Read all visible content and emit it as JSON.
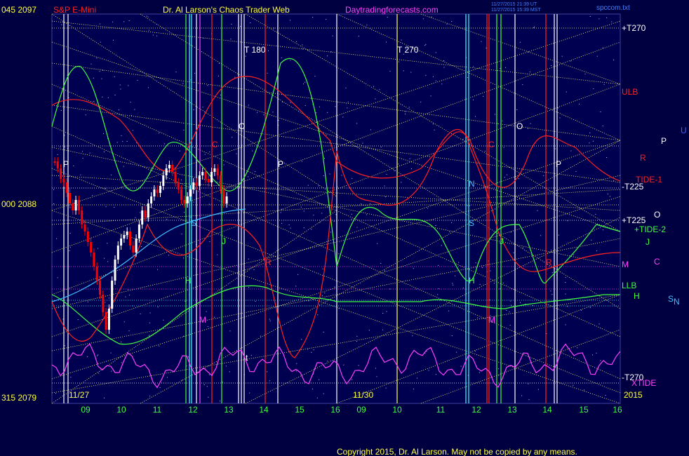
{
  "header": {
    "left_price": "045  2097",
    "instrument": "S&P E-Mini",
    "title": "Dr. Al Larson's Chaos Trader Web",
    "site": "Daytradingforecasts.com",
    "stamp1": "11/27/2015 21:39 UT",
    "stamp2": "11/27/2015 15:39 MST",
    "file": "spccom.txt"
  },
  "axis": {
    "mid_price": "000  2088",
    "low_price": "315  2079",
    "date1": "11/27",
    "date2": "11/30",
    "year": "2015"
  },
  "copyright": "Copyright 2015, Dr. Al Larson. May not be copied by any means.",
  "chart_data": {
    "type": "line",
    "x_ticks": [
      "09",
      "10",
      "11",
      "12",
      "13",
      "14",
      "15",
      "16",
      "09",
      "10",
      "11",
      "12",
      "13",
      "14",
      "15",
      "16"
    ],
    "y_labels": [
      "2097",
      "2088",
      "2079"
    ],
    "right_labels": [
      {
        "text": "+T270",
        "color": "#ffffff"
      },
      {
        "text": "ULB",
        "color": "#ff2020"
      },
      {
        "text": "-T225",
        "color": "#ffffff"
      },
      {
        "text": "TIDE-1",
        "color": "#ff2020"
      },
      {
        "text": "+T225",
        "color": "#ffffff"
      },
      {
        "text": "+TIDE-2",
        "color": "#40ff40"
      },
      {
        "text": "M",
        "color": "#ff40ff"
      },
      {
        "text": "LLB",
        "color": "#40ff40"
      },
      {
        "text": "-T270",
        "color": "#ffffff"
      },
      {
        "text": "XTIDE",
        "color": "#ff40ff"
      }
    ],
    "planet_labels": [
      {
        "text": "U",
        "color": "#4060ff"
      },
      {
        "text": "P",
        "color": "#ffffff"
      },
      {
        "text": "R",
        "color": "#ff2020"
      },
      {
        "text": "O",
        "color": "#ffffff"
      },
      {
        "text": "J",
        "color": "#40ff40"
      },
      {
        "text": "C",
        "color": "#ff40ff"
      },
      {
        "text": "H",
        "color": "#40ff40"
      },
      {
        "text": "S",
        "color": "#40c0ff"
      },
      {
        "text": "N",
        "color": "#40c0ff"
      }
    ],
    "plot_markers": [
      {
        "text": "T   180",
        "color": "#ffffff"
      },
      {
        "text": "T   270",
        "color": "#ffffff"
      },
      {
        "text": "O",
        "color": "#ffffff"
      },
      {
        "text": "P",
        "color": "#ffffff"
      },
      {
        "text": "O",
        "color": "#ffffff"
      },
      {
        "text": "P",
        "color": "#ffffff"
      },
      {
        "text": "N",
        "color": "#40c0ff"
      },
      {
        "text": "S",
        "color": "#40c0ff"
      },
      {
        "text": "S",
        "color": "#40c0ff"
      },
      {
        "text": "H",
        "color": "#40ff40"
      },
      {
        "text": "H",
        "color": "#40ff40"
      },
      {
        "text": "M",
        "color": "#ff40ff"
      },
      {
        "text": "M",
        "color": "#ff40ff"
      },
      {
        "text": "J",
        "color": "#40ff40"
      },
      {
        "text": "J",
        "color": "#40ff40"
      },
      {
        "text": "R",
        "color": "#ff2020"
      },
      {
        "text": "R",
        "color": "#ff2020"
      },
      {
        "text": "C",
        "color": "#ff2020"
      },
      {
        "text": "C",
        "color": "#ff2020"
      },
      {
        "text": "P",
        "color": "#ffffff"
      },
      {
        "text": "t",
        "color": "#ffffff"
      }
    ],
    "series": [
      {
        "name": "ULB",
        "color": "#ff2020"
      },
      {
        "name": "LLB",
        "color": "#40ff40"
      },
      {
        "name": "TIDE-1",
        "color": "#ff2020"
      },
      {
        "name": "+TIDE-2",
        "color": "#40ff40"
      },
      {
        "name": "XTIDE",
        "color": "#ff40ff"
      }
    ],
    "colors": {
      "background": "#000040",
      "grid": "#ffff80",
      "price_up": "#ffffff",
      "price_down": "#ff0000",
      "text_yellow": "#ffff40",
      "text_red": "#ff2020",
      "text_magenta": "#ff40ff",
      "text_blue": "#4080ff"
    }
  }
}
